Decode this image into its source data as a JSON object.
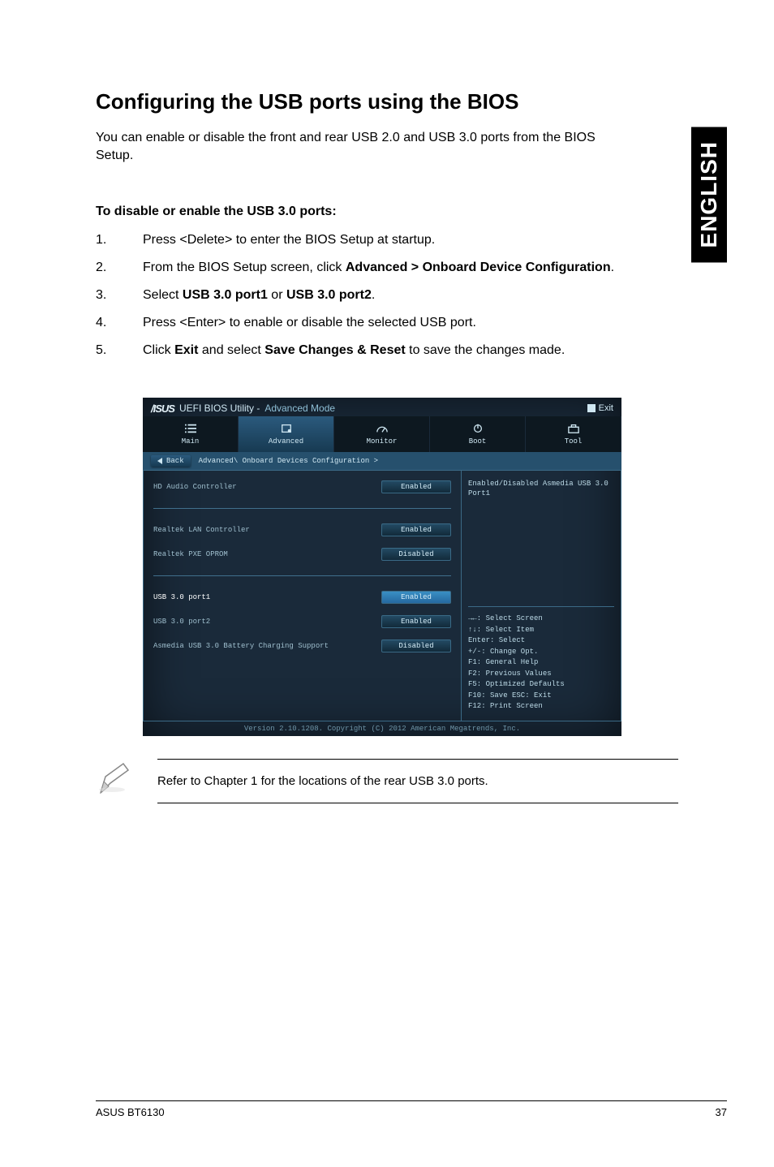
{
  "sideTab": "ENGLISH",
  "heading": "Configuring the USB ports using the BIOS",
  "intro": "You can enable or disable the front and rear USB 2.0 and USB 3.0 ports from the BIOS Setup.",
  "subhead": "To disable or enable the USB 3.0 ports:",
  "steps": {
    "s1": "Press <Delete> to enter the BIOS Setup at startup.",
    "s2_a": "From the BIOS Setup screen, click ",
    "s2_b": "Advanced > Onboard Device Configuration",
    "s2_c": ".",
    "s3_a": "Select ",
    "s3_b": "USB 3.0 port1",
    "s3_c": " or ",
    "s3_d": "USB 3.0 port2",
    "s3_e": ".",
    "s4": "Press <Enter> to enable or disable the selected USB port.",
    "s5_a": "Click ",
    "s5_b": "Exit",
    "s5_c": " and select ",
    "s5_d": "Save Changes & Reset",
    "s5_e": " to save the changes made."
  },
  "bios": {
    "brand": "/ISUS",
    "title_mid": "UEFI BIOS Utility - ",
    "title_mode": "Advanced Mode",
    "exit": "Exit",
    "tabs": {
      "main": "Main",
      "advanced": "Advanced",
      "monitor": "Monitor",
      "boot": "Boot",
      "tool": "Tool"
    },
    "back": "Back",
    "breadcrumb": "Advanced\\ Onboard Devices Configuration >",
    "rows": [
      {
        "label": "HD Audio Controller",
        "value": "Enabled"
      },
      {
        "label": "Realtek LAN Controller",
        "value": "Enabled"
      },
      {
        "label": "Realtek PXE OPROM",
        "value": "Disabled"
      },
      {
        "label": "USB 3.0 port1",
        "value": "Enabled",
        "selected": true
      },
      {
        "label": "USB 3.0 port2",
        "value": "Enabled"
      },
      {
        "label": "Asmedia USB 3.0 Battery Charging Support",
        "value": "Disabled"
      }
    ],
    "help": "Enabled/Disabled Asmedia USB 3.0 Port1",
    "keys": "→←: Select Screen\n↑↓: Select Item\nEnter: Select\n+/-: Change Opt.\nF1: General Help\nF2: Previous Values\nF5: Optimized Defaults\nF10: Save  ESC: Exit\nF12: Print Screen",
    "footer": "Version 2.10.1208. Copyright (C) 2012 American Megatrends, Inc."
  },
  "note": "Refer to Chapter 1 for the locations of the rear USB 3.0 ports.",
  "footer": {
    "left": "ASUS BT6130",
    "right": "37"
  }
}
